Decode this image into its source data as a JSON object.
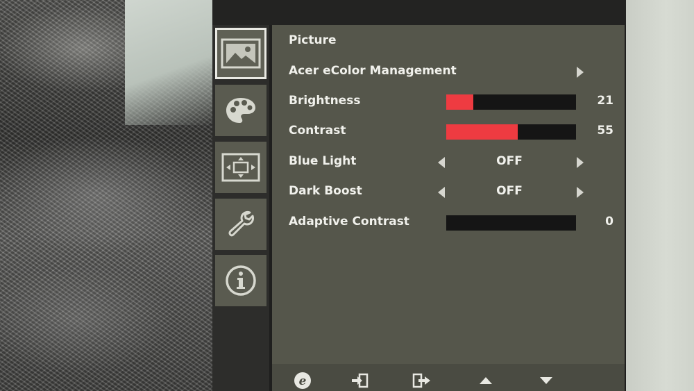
{
  "colors": {
    "accent": "#ee3b41",
    "panel": "#55564b",
    "text": "#f1f1ec"
  },
  "tabs": [
    {
      "icon": "picture-icon",
      "active": true
    },
    {
      "icon": "palette-icon",
      "active": false
    },
    {
      "icon": "screen-size-icon",
      "active": false
    },
    {
      "icon": "wrench-icon",
      "active": false
    },
    {
      "icon": "info-icon",
      "active": false
    }
  ],
  "menu": {
    "title": "Picture",
    "rows": {
      "ecolor": {
        "label": "Acer eColor Management"
      },
      "brightness": {
        "label": "Brightness",
        "value": "21",
        "level": 21,
        "max": 100
      },
      "contrast": {
        "label": "Contrast",
        "value": "55",
        "level": 55,
        "max": 100
      },
      "blue_light": {
        "label": "Blue Light",
        "value": "OFF"
      },
      "dark_boost": {
        "label": "Dark Boost",
        "value": "OFF"
      },
      "adaptive_contrast": {
        "label": "Adaptive Contrast",
        "value": "0",
        "level": 0,
        "max": 100
      }
    }
  },
  "bottom_bar": {
    "buttons": [
      "ecolor-button-icon",
      "enter-icon",
      "exit-icon",
      "up-arrow-icon",
      "down-arrow-icon"
    ],
    "ecolor_glyph": "e"
  }
}
